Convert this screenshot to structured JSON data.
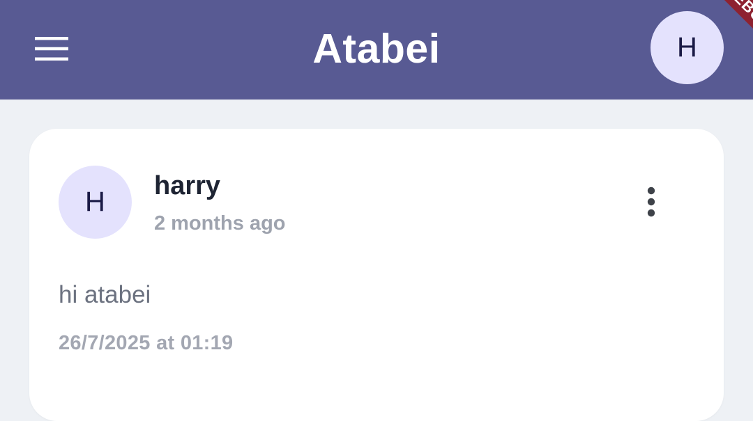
{
  "app_bar": {
    "title": "Atabei",
    "menu_icon": "hamburger-menu-icon",
    "profile_initial": "H",
    "background_color": "#585A93"
  },
  "debug_banner": {
    "label": "DEBUG"
  },
  "post": {
    "author_initial": "H",
    "author_name": "harry",
    "time_ago": "2 months ago",
    "more_icon": "more-vertical-icon",
    "content": "hi atabei",
    "timestamp": "26/7/2025 at 01:19"
  },
  "colors": {
    "avatar_background": "#E4E2FD",
    "page_background": "#EEF1F5",
    "card_background": "#FFFFFF"
  }
}
